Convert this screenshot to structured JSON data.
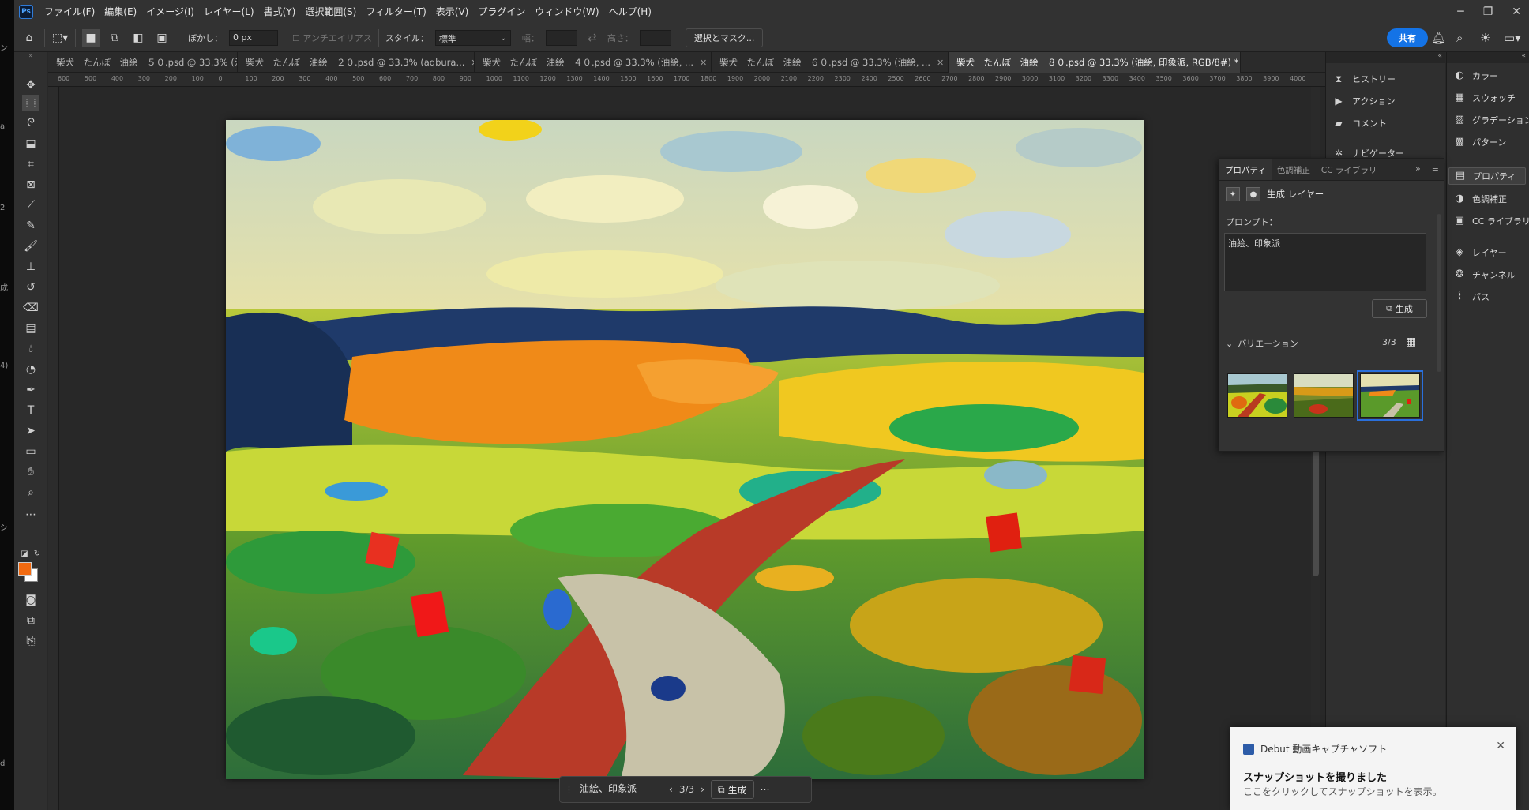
{
  "desktop_strip": [
    "ン",
    "ai",
    "2",
    "成",
    "4)",
    "シ",
    "d"
  ],
  "menu": [
    "ファイル(F)",
    "編集(E)",
    "イメージ(I)",
    "レイヤー(L)",
    "書式(Y)",
    "選択範囲(S)",
    "フィルター(T)",
    "表示(V)",
    "プラグイン",
    "ウィンドウ(W)",
    "ヘルプ(H)"
  ],
  "app_logo": "Ps",
  "options": {
    "feather_label": "ぼかし：",
    "feather_value": "0 px",
    "antialias_label": "アンチエイリアス",
    "style_label": "スタイル：",
    "style_value": "標準",
    "width_label": "幅：",
    "height_label": "高さ：",
    "select_mask_label": "選択とマスク...",
    "share_label": "共有"
  },
  "tabs": [
    {
      "title": "柴犬　たんぼ　油絵　５０.psd @ 33.3% (油絵, ...",
      "active": false
    },
    {
      "title": "柴犬　たんぼ　油絵　２０.psd @ 33.3% (aqbura...",
      "active": false
    },
    {
      "title": "柴犬　たんぼ　油絵　４０.psd @ 33.3% (油絵, ...",
      "active": false
    },
    {
      "title": "柴犬　たんぼ　油絵　６０.psd @ 33.3% (油絵, ...",
      "active": false
    },
    {
      "title": "柴犬　たんぼ　油絵　８０.psd @ 33.3% (油絵, 印象派, RGB/8#) *",
      "active": true
    }
  ],
  "ruler_ticks": [
    "600",
    "500",
    "400",
    "300",
    "200",
    "100",
    "0",
    "100",
    "200",
    "300",
    "400",
    "500",
    "600",
    "700",
    "800",
    "900",
    "1000",
    "1100",
    "1200",
    "1300",
    "1400",
    "1500",
    "1600",
    "1700",
    "1800",
    "1900",
    "2000",
    "2100",
    "2200",
    "2300",
    "2400",
    "2500",
    "2600",
    "2700",
    "2800",
    "2900",
    "3000",
    "3100",
    "3200",
    "3300",
    "3400",
    "3500",
    "3600",
    "3700",
    "3800",
    "3900",
    "4000"
  ],
  "taskbar": {
    "prompt": "油絵、印象派",
    "counter": "3/3",
    "generate_label": "生成",
    "more": "⋯"
  },
  "history_panel": [
    {
      "icon": "history-icon",
      "label": "ヒストリー"
    },
    {
      "icon": "play-icon",
      "label": "アクション"
    },
    {
      "icon": "comment-icon",
      "label": "コメント"
    },
    {
      "icon": "navigator-icon",
      "label": "ナビゲーター"
    }
  ],
  "right_panel": [
    {
      "icon": "color-icon",
      "label": "カラー",
      "active": false
    },
    {
      "icon": "swatches-icon",
      "label": "スウォッチ",
      "active": false
    },
    {
      "icon": "gradient-icon",
      "label": "グラデーション",
      "active": false
    },
    {
      "icon": "pattern-icon",
      "label": "パターン",
      "active": false
    },
    {
      "icon": "properties-icon",
      "label": "プロパティ",
      "active": true
    },
    {
      "icon": "adjustments-icon",
      "label": "色調補正",
      "active": false
    },
    {
      "icon": "cc-libraries-icon",
      "label": "CC ライブラリ",
      "active": false
    },
    {
      "icon": "layers-icon",
      "label": "レイヤー",
      "active": false
    },
    {
      "icon": "channels-icon",
      "label": "チャンネル",
      "active": false
    },
    {
      "icon": "paths-icon",
      "label": "パス",
      "active": false
    }
  ],
  "properties": {
    "tabs": [
      "プロパティ",
      "色調補正",
      "CC ライブラリ"
    ],
    "layer_type": "生成 レイヤー",
    "prompt_label": "プロンプト：",
    "prompt_value": "油絵、印象派",
    "generate_label": "生成",
    "variations_label": "バリエーション",
    "variations_count": "3/3"
  },
  "toast": {
    "app": "Debut 動画キャプチャソフト",
    "title": "スナップショットを撮りました",
    "body": "ここをクリックしてスナップショットを表示。"
  },
  "colors": {
    "foreground": "#f26a10",
    "background": "#ffffff",
    "accent": "#1473e6"
  }
}
